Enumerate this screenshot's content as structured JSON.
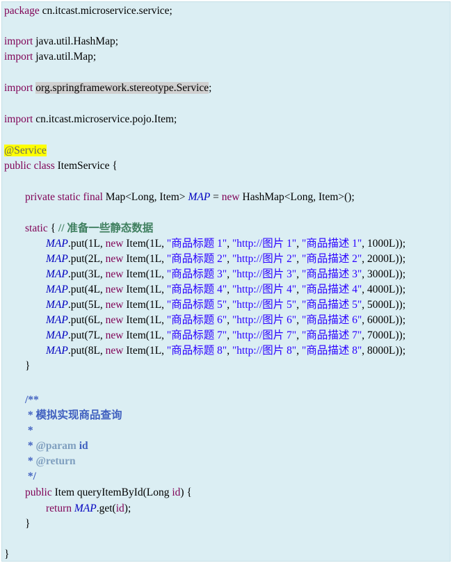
{
  "code": {
    "pkg_kw": "package",
    "pkg_name": " cn.itcast.microservice.service;",
    "import_kw": "import",
    "import_1": " java.util.HashMap;",
    "import_2": " java.util.Map;",
    "import_3_name": "org.springframework.stereotype.Service",
    "semicolon": ";",
    "import_4": " cn.itcast.microservice.pojo.Item;",
    "annotation": "@Service",
    "class_kw": "public class",
    "class_name": " ItemService {",
    "field_mods": "private static final",
    "field_type": " Map<Long, Item> ",
    "map_field": "MAP",
    "assign": " = ",
    "new_kw": "new",
    "field_init": " HashMap<Long, Item>();",
    "static_kw": "static",
    "static_open": " { ",
    "static_comment": "// 准备一些静态数据",
    "put_prefix": ".put(",
    "item_ctor": " Item(1L, ",
    "puts": [
      {
        "id": "1L, ",
        "title": "\"商品标题 1\"",
        "pic": "\"http://图片 1\"",
        "desc": "\"商品描述 1\"",
        "price": ", 1000L));"
      },
      {
        "id": "2L, ",
        "title": "\"商品标题 2\"",
        "pic": "\"http://图片 2\"",
        "desc": "\"商品描述 2\"",
        "price": ", 2000L));"
      },
      {
        "id": "3L, ",
        "title": "\"商品标题 3\"",
        "pic": "\"http://图片 3\"",
        "desc": "\"商品描述 3\"",
        "price": ", 3000L));"
      },
      {
        "id": "4L, ",
        "title": "\"商品标题 4\"",
        "pic": "\"http://图片 4\"",
        "desc": "\"商品描述 4\"",
        "price": ", 4000L));"
      },
      {
        "id": "5L, ",
        "title": "\"商品标题 5\"",
        "pic": "\"http://图片 5\"",
        "desc": "\"商品描述 5\"",
        "price": ", 5000L));"
      },
      {
        "id": "6L, ",
        "title": "\"商品标题 6\"",
        "pic": "\"http://图片 6\"",
        "desc": "\"商品描述 6\"",
        "price": ", 6000L));"
      },
      {
        "id": "7L, ",
        "title": "\"商品标题 7\"",
        "pic": "\"http://图片 7\"",
        "desc": "\"商品描述 7\"",
        "price": ", 7000L));"
      },
      {
        "id": "8L, ",
        "title": "\"商品标题 8\"",
        "pic": "\"http://图片 8\"",
        "desc": "\"商品描述 8\"",
        "price": ", 8000L));"
      }
    ],
    "sep": ", ",
    "close_brace": "}",
    "doc_open": "/**",
    "doc_desc": " * 模拟实现商品查询",
    "doc_blank": " *",
    "doc_star": " * ",
    "param_tag": "@param",
    "param_name": " id",
    "return_tag": "@return",
    "doc_close": " */",
    "method_kw": "public",
    "method_sig_1": " Item queryItemById(Long ",
    "id_word": "id",
    "method_sig_2": ") {",
    "return_kw": "return",
    "get_prefix": ".get(",
    "get_suffix": ");"
  }
}
